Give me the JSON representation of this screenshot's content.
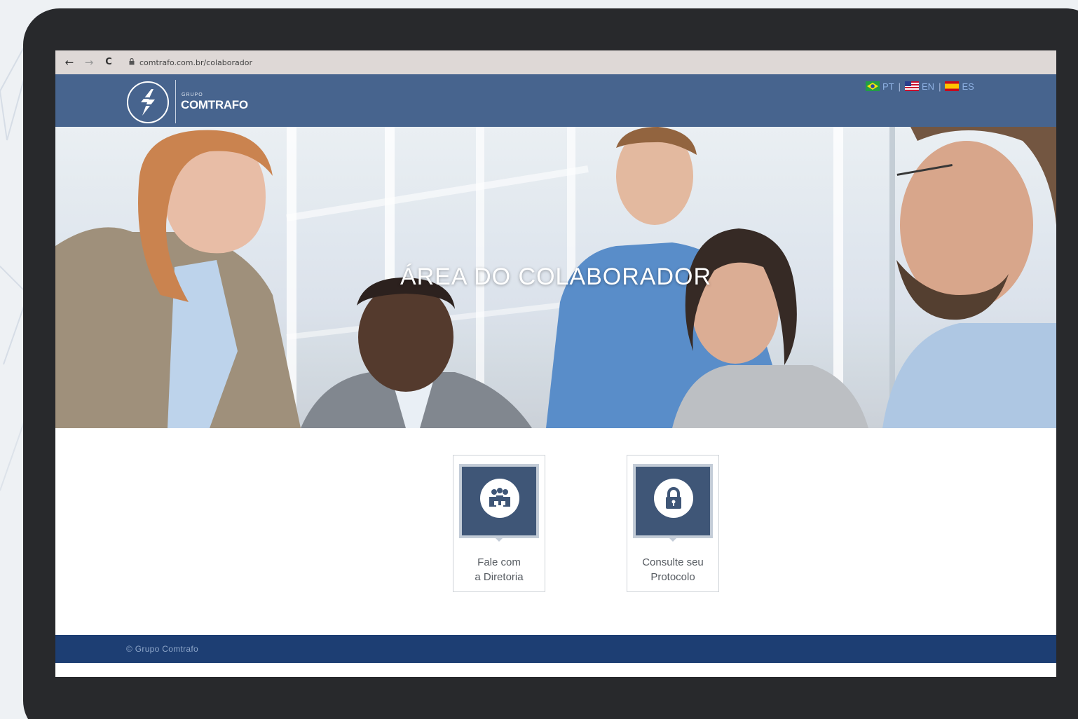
{
  "browser": {
    "url": "comtrafo.com.br/colaborador",
    "back_icon": "←",
    "forward_icon": "→",
    "reload_icon": "C"
  },
  "header": {
    "logo_group": "GRUPO",
    "logo_name": "COMTRAFO",
    "languages": [
      {
        "code": "PT",
        "flag": "brazil-flag-icon"
      },
      {
        "code": "EN",
        "flag": "usa-flag-icon"
      },
      {
        "code": "ES",
        "flag": "spain-flag-icon"
      }
    ]
  },
  "hero": {
    "title": "ÁREA DO COLABORADOR"
  },
  "cards": [
    {
      "line1": "Fale com",
      "line2": "a Diretoria",
      "icon": "meeting-people-icon"
    },
    {
      "line1": "Consulte seu",
      "line2": "Protocolo",
      "icon": "padlock-icon"
    }
  ],
  "footer": {
    "copyright": "© Grupo Comtrafo"
  },
  "colors": {
    "header": "#47648e",
    "footer": "#1d3e73",
    "card_icon_bg": "#3f5677",
    "device": "#28292c"
  }
}
